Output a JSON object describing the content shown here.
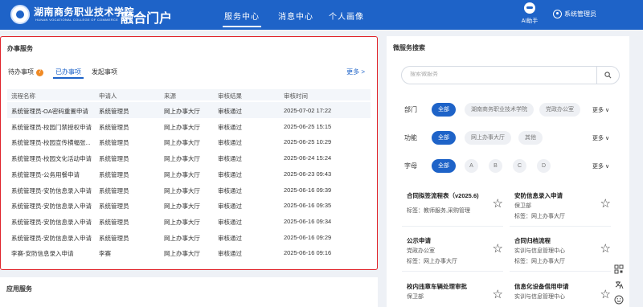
{
  "header": {
    "school_cn": "湖南商务职业技术学院",
    "school_en": "HUNAN VOCATIONAL COLLEGE OF COMMERCE",
    "portal_title": "融合门户",
    "nav": [
      "服务中心",
      "消息中心",
      "个人画像"
    ],
    "ai_label": "AI助手",
    "user_name": "系统管理员"
  },
  "ban_service": {
    "title": "办事服务",
    "tabs": [
      "待办事项",
      "已办事项",
      "发起事项"
    ],
    "pending_count": "7",
    "more": "更多 >",
    "columns": [
      "流程名称",
      "申请人",
      "来源",
      "审核结果",
      "审核时间"
    ],
    "rows": [
      [
        "系统管理员-OA密码重置申请",
        "系统管理员",
        "网上办事大厅",
        "审核通过",
        "2025-07-02 17:22"
      ],
      [
        "系统管理员-校园门禁授权申请",
        "系统管理员",
        "网上办事大厅",
        "审核通过",
        "2025-06-25 15:15"
      ],
      [
        "系统管理员-校园宣传横幅张...",
        "系统管理员",
        "网上办事大厅",
        "审核通过",
        "2025-06-25 10:29"
      ],
      [
        "系统管理员-校园文化活动申请",
        "系统管理员",
        "网上办事大厅",
        "审核通过",
        "2025-06-24 15:24"
      ],
      [
        "系统管理员-公务用餐申请",
        "系统管理员",
        "网上办事大厅",
        "审核通过",
        "2025-06-23 09:43"
      ],
      [
        "系统管理员-安防信息录入申请",
        "系统管理员",
        "网上办事大厅",
        "审核通过",
        "2025-06-16 09:39"
      ],
      [
        "系统管理员-安防信息录入申请",
        "系统管理员",
        "网上办事大厅",
        "审核通过",
        "2025-06-16 09:35"
      ],
      [
        "系统管理员-安防信息录入申请",
        "系统管理员",
        "网上办事大厅",
        "审核通过",
        "2025-06-16 09:34"
      ],
      [
        "系统管理员-安防信息录入申请",
        "系统管理员",
        "网上办事大厅",
        "审核通过",
        "2025-06-16 09:29"
      ],
      [
        "李赛-安防信息录入申请",
        "李赛",
        "网上办事大厅",
        "审核通过",
        "2025-06-16 09:16"
      ]
    ]
  },
  "app_service": {
    "title": "应用服务"
  },
  "micro_search": {
    "title": "微服务搜索",
    "placeholder": "搜索微服务",
    "filters": [
      {
        "label": "部门",
        "chips": [
          "全部",
          "湖南商务职业技术学院",
          "党政办公室"
        ],
        "more": "更多 ∨"
      },
      {
        "label": "功能",
        "chips": [
          "全部",
          "网上办事大厅",
          "其他"
        ],
        "more": "更多 ∨"
      },
      {
        "label": "字母",
        "chips": [
          "全部",
          "A",
          "B",
          "C",
          "D"
        ],
        "more": "更多 ∨"
      }
    ],
    "cards": [
      {
        "title": "合同拟签流程表（v2025.6)",
        "lines": [
          "标签：教师服务,采购管理"
        ]
      },
      {
        "title": "安防信息录入申请",
        "lines": [
          "保卫部",
          "标签：网上办事大厅"
        ]
      },
      {
        "title": "公示申请",
        "lines": [
          "党政办公室",
          "标签：网上办事大厅"
        ]
      },
      {
        "title": "合同归档流程",
        "lines": [
          "实训与信息管理中心",
          "标签：网上办事大厅"
        ]
      },
      {
        "title": "校内违章车辆处理审批",
        "lines": [
          "保卫部"
        ]
      },
      {
        "title": "信息化设备借用申请",
        "lines": [
          "实训与信息管理中心"
        ]
      }
    ]
  },
  "colors": {
    "brand": "#1e63c8",
    "highlight_border": "#e0232a",
    "badge": "#f08a24"
  }
}
